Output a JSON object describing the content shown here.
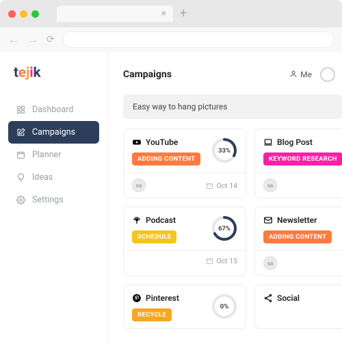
{
  "logo": {
    "text": "tejik"
  },
  "sidebar": {
    "items": [
      {
        "label": "Dashboard",
        "icon": "grid"
      },
      {
        "label": "Campaigns",
        "icon": "edit",
        "active": true
      },
      {
        "label": "Planner",
        "icon": "calendar"
      },
      {
        "label": "Ideas",
        "icon": "bulb"
      },
      {
        "label": "Settings",
        "icon": "gear"
      }
    ]
  },
  "header": {
    "title": "Campaigns",
    "me_label": "Me"
  },
  "campaign": {
    "title": "Easy way to hang pictures"
  },
  "cards": [
    {
      "title": "YouTube",
      "icon": "youtube",
      "status": "ADDING CONTENT",
      "status_color": "#ff7a3d",
      "progress": 33,
      "footer": {
        "avatar": "sa",
        "date": "Oct 14"
      }
    },
    {
      "title": "Blog Post",
      "icon": "laptop",
      "status": "KEYWORD RESEARCH",
      "status_color": "#ff1fa6",
      "progress": null,
      "footer": {
        "avatar": "sa",
        "date": null
      }
    },
    {
      "title": "Podcast",
      "icon": "podcast",
      "status": "SCHEDULE",
      "status_color": "#f5c518",
      "progress": 67,
      "footer": {
        "avatar": null,
        "date": "Oct 15"
      }
    },
    {
      "title": "Newsletter",
      "icon": "mail",
      "status": "ADDING CONTENT",
      "status_color": "#ff7a3d",
      "progress": null,
      "footer": {
        "avatar": "sa",
        "date": null
      }
    },
    {
      "title": "Pinterest",
      "icon": "pinterest",
      "status": "RECYCLE",
      "status_color": "#f5a623",
      "progress": 0,
      "footer": null
    },
    {
      "title": "Social",
      "icon": "share",
      "status": null,
      "status_color": null,
      "progress": null,
      "footer": null
    }
  ],
  "colors": {
    "accent_dark": "#2c3e5a",
    "ring_track": "#e6e6e6",
    "ring_fill": "#2c3e5a"
  }
}
